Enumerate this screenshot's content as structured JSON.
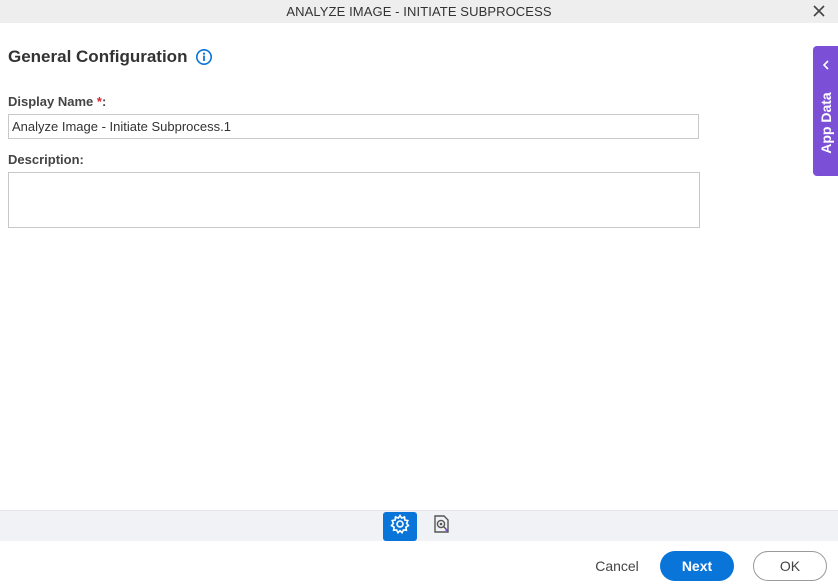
{
  "window": {
    "title": "ANALYZE IMAGE - INITIATE SUBPROCESS",
    "close_icon": "close-icon"
  },
  "section": {
    "heading": "General Configuration",
    "info_icon": "info-icon"
  },
  "form": {
    "display_name_label": "Display Name",
    "required_mark": "*",
    "label_suffix": ":",
    "display_name_value": "Analyze Image - Initiate Subprocess.1",
    "description_label": "Description:",
    "description_value": ""
  },
  "side_panel": {
    "label": "App Data",
    "icon": "chevron-left-icon"
  },
  "tabs": [
    {
      "icon": "gear-icon",
      "active": true
    },
    {
      "icon": "image-search-icon",
      "active": false
    }
  ],
  "footer": {
    "cancel_label": "Cancel",
    "next_label": "Next",
    "ok_label": "OK"
  },
  "colors": {
    "accent": "#0a75d9",
    "side_panel": "#7b4fd6",
    "required": "#d9232e"
  }
}
